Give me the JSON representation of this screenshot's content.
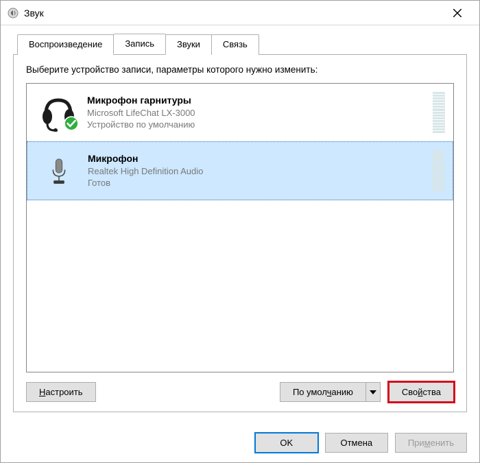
{
  "window": {
    "title": "Звук"
  },
  "tabs": {
    "playback": "Воспроизведение",
    "recording": "Запись",
    "sounds": "Звуки",
    "communications": "Связь"
  },
  "panel": {
    "instruction": "Выберите устройство записи, параметры которого нужно изменить:"
  },
  "devices": [
    {
      "name": "Микрофон гарнитуры",
      "vendor": "Microsoft LifeChat LX-3000",
      "status": "Устройство по умолчанию",
      "selected": false,
      "default": true,
      "icon": "headset"
    },
    {
      "name": "Микрофон",
      "vendor": "Realtek High Definition Audio",
      "status": "Готов",
      "selected": true,
      "default": false,
      "icon": "mic"
    }
  ],
  "buttons": {
    "configure": "Настроить",
    "setdefault": "По умолчанию",
    "properties": "Свойства",
    "ok": "OK",
    "cancel": "Отмена",
    "apply": "Применить"
  }
}
